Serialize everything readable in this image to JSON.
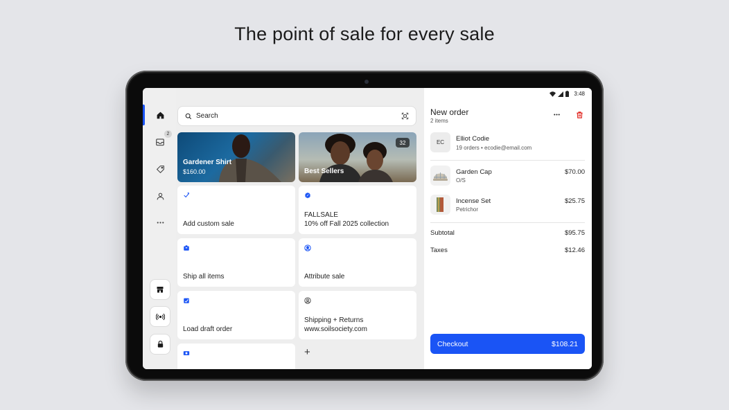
{
  "headline": "The point of sale for every sale",
  "status_bar": {
    "time": "3:48"
  },
  "nav": {
    "inbox_badge": "2"
  },
  "search": {
    "placeholder": "Search"
  },
  "tiles": {
    "gardener_shirt": {
      "name": "Gardener Shirt",
      "price": "$160.00"
    },
    "best_sellers": {
      "name": "Best Sellers",
      "count": "32"
    },
    "custom_sale": "Add custom sale",
    "discount_code": "FALLSALE",
    "discount_desc": "10% off Fall 2025 collection",
    "ship_all": "Ship all items",
    "attribute": "Attribute sale",
    "load_draft": "Load draft order",
    "shipping_returns": "Shipping + Returns",
    "shipping_url": "www.soilsociety.com",
    "add_tile": "+"
  },
  "order": {
    "title": "New order",
    "item_count": "2 items",
    "customer": {
      "initials": "EC",
      "name": "Elliot Codie",
      "meta": "19 orders • ecodie@email.com"
    },
    "items": [
      {
        "name": "Garden Cap",
        "variant": "O/S",
        "price": "$70.00"
      },
      {
        "name": "Incense Set",
        "variant": "Petrichor",
        "price": "$25.75"
      }
    ],
    "subtotal_label": "Subtotal",
    "subtotal": "$95.75",
    "taxes_label": "Taxes",
    "taxes": "$12.46",
    "checkout_label": "Checkout",
    "checkout_total": "$108.21"
  },
  "colors": {
    "accent": "#1a54f5",
    "danger": "#e0201a"
  }
}
